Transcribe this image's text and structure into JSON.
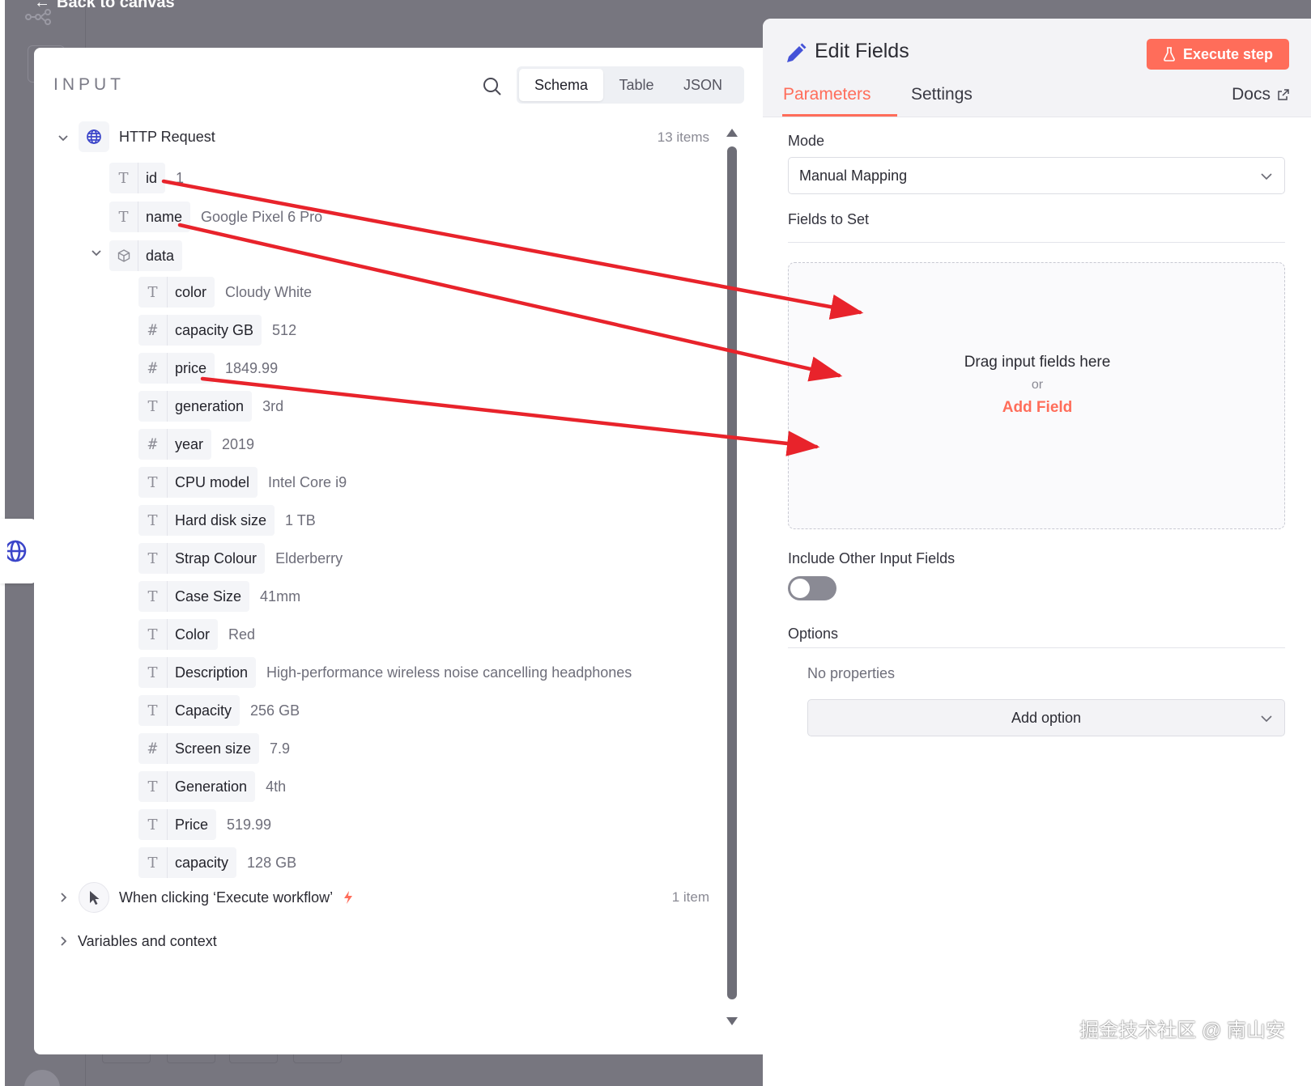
{
  "backdrop": {
    "back_label": "Back to canvas"
  },
  "input_panel": {
    "title": "INPUT",
    "view_tabs": [
      {
        "label": "Schema",
        "active": true
      },
      {
        "label": "Table",
        "active": false
      },
      {
        "label": "JSON",
        "active": false
      }
    ],
    "http_node": {
      "label": "HTTP Request",
      "count": "13 items",
      "icon": "globe-icon"
    },
    "fields": [
      {
        "type": "string",
        "key": "id",
        "value": "1"
      },
      {
        "type": "string",
        "key": "name",
        "value": "Google Pixel 6 Pro"
      },
      {
        "type": "object",
        "key": "data",
        "value": ""
      }
    ],
    "data_fields": [
      {
        "type": "string",
        "key": "color",
        "value": "Cloudy White"
      },
      {
        "type": "number",
        "key": "capacity GB",
        "value": "512"
      },
      {
        "type": "number",
        "key": "price",
        "value": "1849.99"
      },
      {
        "type": "string",
        "key": "generation",
        "value": "3rd"
      },
      {
        "type": "number",
        "key": "year",
        "value": "2019"
      },
      {
        "type": "string",
        "key": "CPU model",
        "value": "Intel Core i9"
      },
      {
        "type": "string",
        "key": "Hard disk size",
        "value": "1 TB"
      },
      {
        "type": "string",
        "key": "Strap Colour",
        "value": "Elderberry"
      },
      {
        "type": "string",
        "key": "Case Size",
        "value": "41mm"
      },
      {
        "type": "string",
        "key": "Color",
        "value": "Red"
      },
      {
        "type": "string",
        "key": "Description",
        "value": "High-performance wireless noise cancelling headphones"
      },
      {
        "type": "string",
        "key": "Capacity",
        "value": "256 GB"
      },
      {
        "type": "number",
        "key": "Screen size",
        "value": "7.9"
      },
      {
        "type": "string",
        "key": "Generation",
        "value": "4th"
      },
      {
        "type": "string",
        "key": "Price",
        "value": "519.99"
      },
      {
        "type": "string",
        "key": "capacity",
        "value": "128 GB"
      }
    ],
    "trigger_node": {
      "label": "When clicking ‘Execute workflow’",
      "count": "1 item",
      "icon": "pointer-icon"
    },
    "variables_label": "Variables and context"
  },
  "edit_panel": {
    "title": "Edit Fields",
    "execute_label": "Execute step",
    "tabs": [
      {
        "label": "Parameters",
        "active": true
      },
      {
        "label": "Settings",
        "active": false
      }
    ],
    "docs_label": "Docs",
    "mode_label": "Mode",
    "mode_value": "Manual Mapping",
    "fields_to_set_label": "Fields to Set",
    "dropzone_text": "Drag input fields here",
    "dropzone_or": "or",
    "add_field_label": "Add Field",
    "include_other_label": "Include Other Input Fields",
    "include_other_enabled": false,
    "options_label": "Options",
    "no_properties": "No properties",
    "add_option_label": "Add option"
  },
  "watermark": "掘金技术社区 @ 南山安",
  "colors": {
    "accent": "#ff6d5a",
    "backdrop": "#77767f",
    "annotation_arrow": "#e8232b",
    "pencil": "#4452d8"
  }
}
